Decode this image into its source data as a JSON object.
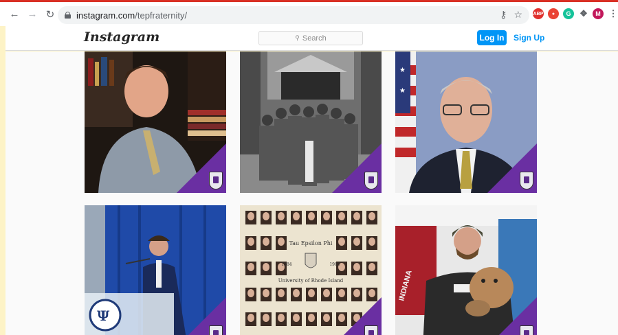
{
  "browser": {
    "url_host": "instagram.com",
    "url_path": "/tepfraternity/",
    "ext_adblock": "ABP",
    "ext_g": "G",
    "profile_initial": "M"
  },
  "ig": {
    "logo": "Instagram",
    "search_placeholder": "Search",
    "login_label": "Log In",
    "signup_label": "Sign Up"
  },
  "posts": [
    {
      "subject": "man-smiling-bookshelf"
    },
    {
      "subject": "vintage-group-photo"
    },
    {
      "subject": "older-man-flag"
    },
    {
      "subject": "speaker-at-podium"
    },
    {
      "subject": "university-of-rhode-island-composite",
      "heading": "Tau Epsilon Phi",
      "years_left": "1984",
      "years_right": "1985",
      "caption": "University of Rhode Island"
    },
    {
      "subject": "man-with-puppy",
      "sign_text": "INDIANA"
    }
  ],
  "colors": {
    "accent": "#0095f6",
    "badge": "#6a2fa2"
  }
}
